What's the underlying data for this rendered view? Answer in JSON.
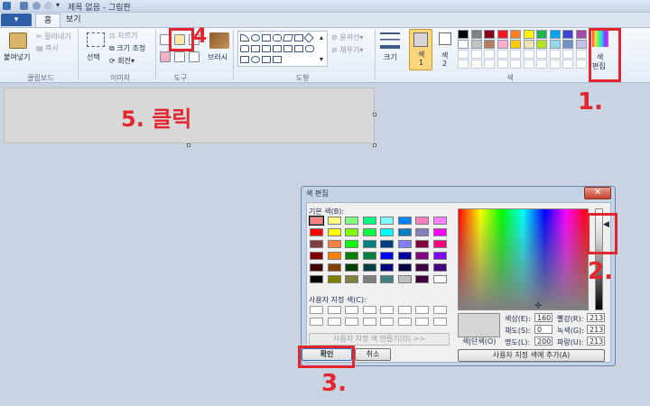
{
  "window": {
    "title": "제목 없음 - 그림판"
  },
  "tabs": {
    "file_label": "▾",
    "home": "홈",
    "view": "보기"
  },
  "ribbon": {
    "clipboard": {
      "paste": "붙여넣기",
      "cut": "잘라내기",
      "copy": "복사",
      "group": "클립보드"
    },
    "image": {
      "select": "선택",
      "crop": "자르기",
      "resize": "크기 조정",
      "rotate": "회전",
      "group": "이미지"
    },
    "tools": {
      "group": "도구"
    },
    "brushes": {
      "label": "브러시"
    },
    "shapes": {
      "outline": "윤곽선",
      "fill": "채우기",
      "group": "도형"
    },
    "size": {
      "label": "크기"
    },
    "colors": {
      "color1": "색\n1",
      "color1_a": "색",
      "color1_b": "1",
      "color2_a": "색",
      "color2_b": "2",
      "group": "색",
      "edit_a": "색",
      "edit_b": "편집",
      "palette": [
        "#000000",
        "#7f7f7f",
        "#880015",
        "#ed1c24",
        "#ff7f27",
        "#fff200",
        "#22b14c",
        "#00a2e8",
        "#3f48cc",
        "#a349a4",
        "#ffffff",
        "#c3c3c3",
        "#b97a57",
        "#ffaec9",
        "#ffc90e",
        "#efe4b0",
        "#b5e61d",
        "#99d9ea",
        "#7092be",
        "#c8bfe7"
      ]
    }
  },
  "annotations": {
    "step1": "1.",
    "step2": "2.",
    "step3": "3.",
    "step4": "4",
    "step5": "5. 클릭"
  },
  "dialog": {
    "title": "색 편집",
    "basic_label": "기본 색(B):",
    "custom_label": "사용자 지정 색(C):",
    "define_custom": "사용자 지정 색 만들기(D) >>",
    "ok": "확인",
    "cancel": "취소",
    "solid_label": "색|단색(O)",
    "add_custom": "사용자 지정 색에 추가(A)",
    "hue_label": "색상(E):",
    "hue": "160",
    "sat_label": "채도(S):",
    "sat": "0",
    "lum_label": "명도(L):",
    "lum": "200",
    "red_label": "빨강(R):",
    "red": "213",
    "green_label": "녹색(G):",
    "green": "213",
    "blue_label": "파랑(U):",
    "blue": "213",
    "basic_colors": [
      "#ff8080",
      "#ffff80",
      "#80ff80",
      "#00ff80",
      "#80ffff",
      "#0080ff",
      "#ff80c0",
      "#ff80ff",
      "#ff0000",
      "#ffff00",
      "#80ff00",
      "#00ff40",
      "#00ffff",
      "#0080c0",
      "#8080c0",
      "#ff00ff",
      "#804040",
      "#ff8040",
      "#00ff00",
      "#008080",
      "#004080",
      "#8080ff",
      "#800040",
      "#ff0080",
      "#800000",
      "#ff8000",
      "#008000",
      "#008040",
      "#0000ff",
      "#0000a0",
      "#800080",
      "#8000ff",
      "#400000",
      "#804000",
      "#004000",
      "#004040",
      "#000080",
      "#000040",
      "#400040",
      "#400080",
      "#000000",
      "#808000",
      "#808040",
      "#808080",
      "#408080",
      "#c0c0c0",
      "#400040",
      "#ffffff"
    ]
  },
  "colors": {
    "accent_red": "#e3262e"
  }
}
